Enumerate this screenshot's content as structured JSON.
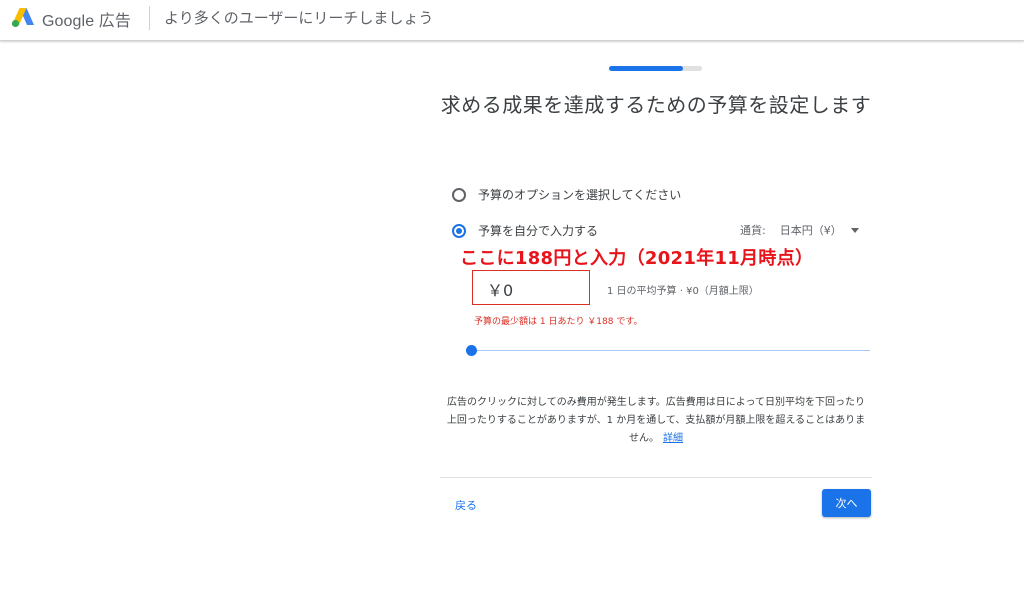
{
  "header": {
    "brand_google": "Google",
    "brand_product": "広告",
    "title": "より多くのユーザーにリーチしましょう"
  },
  "progress": {
    "fraction": 0.8
  },
  "heading": "求める成果を達成するための予算を設定します",
  "options": [
    {
      "label": "予算のオプションを選択してください",
      "selected": false
    },
    {
      "label": "予算を自分で入力する",
      "selected": true
    }
  ],
  "currency": {
    "label": "通貨:",
    "value": "日本円（¥）"
  },
  "annotation": "ここに188円と入力（2021年11月時点）",
  "budget": {
    "value": "￥0",
    "avg_text": "1 日の平均予算 · ¥0（月額上限）",
    "error_text": "予算の最少額は 1 日あたり ￥188 です。"
  },
  "slider": {
    "value_fraction": 0.0
  },
  "info": {
    "text": "広告のクリックに対してのみ費用が発生します。広告費用は日によって日別平均を下回ったり上回ったりすることがありますが、1 か月を通して、支払額が月額上限を超えることはありません。",
    "link": "詳細"
  },
  "footer": {
    "back_label": "戻る",
    "next_label": "次へ"
  },
  "colors": {
    "accent": "#1a73e8",
    "error": "#d93025",
    "annotation": "#e8141b"
  },
  "icons": {
    "logo": "google-ads-logo-icon",
    "dropdown": "caret-down-icon"
  }
}
